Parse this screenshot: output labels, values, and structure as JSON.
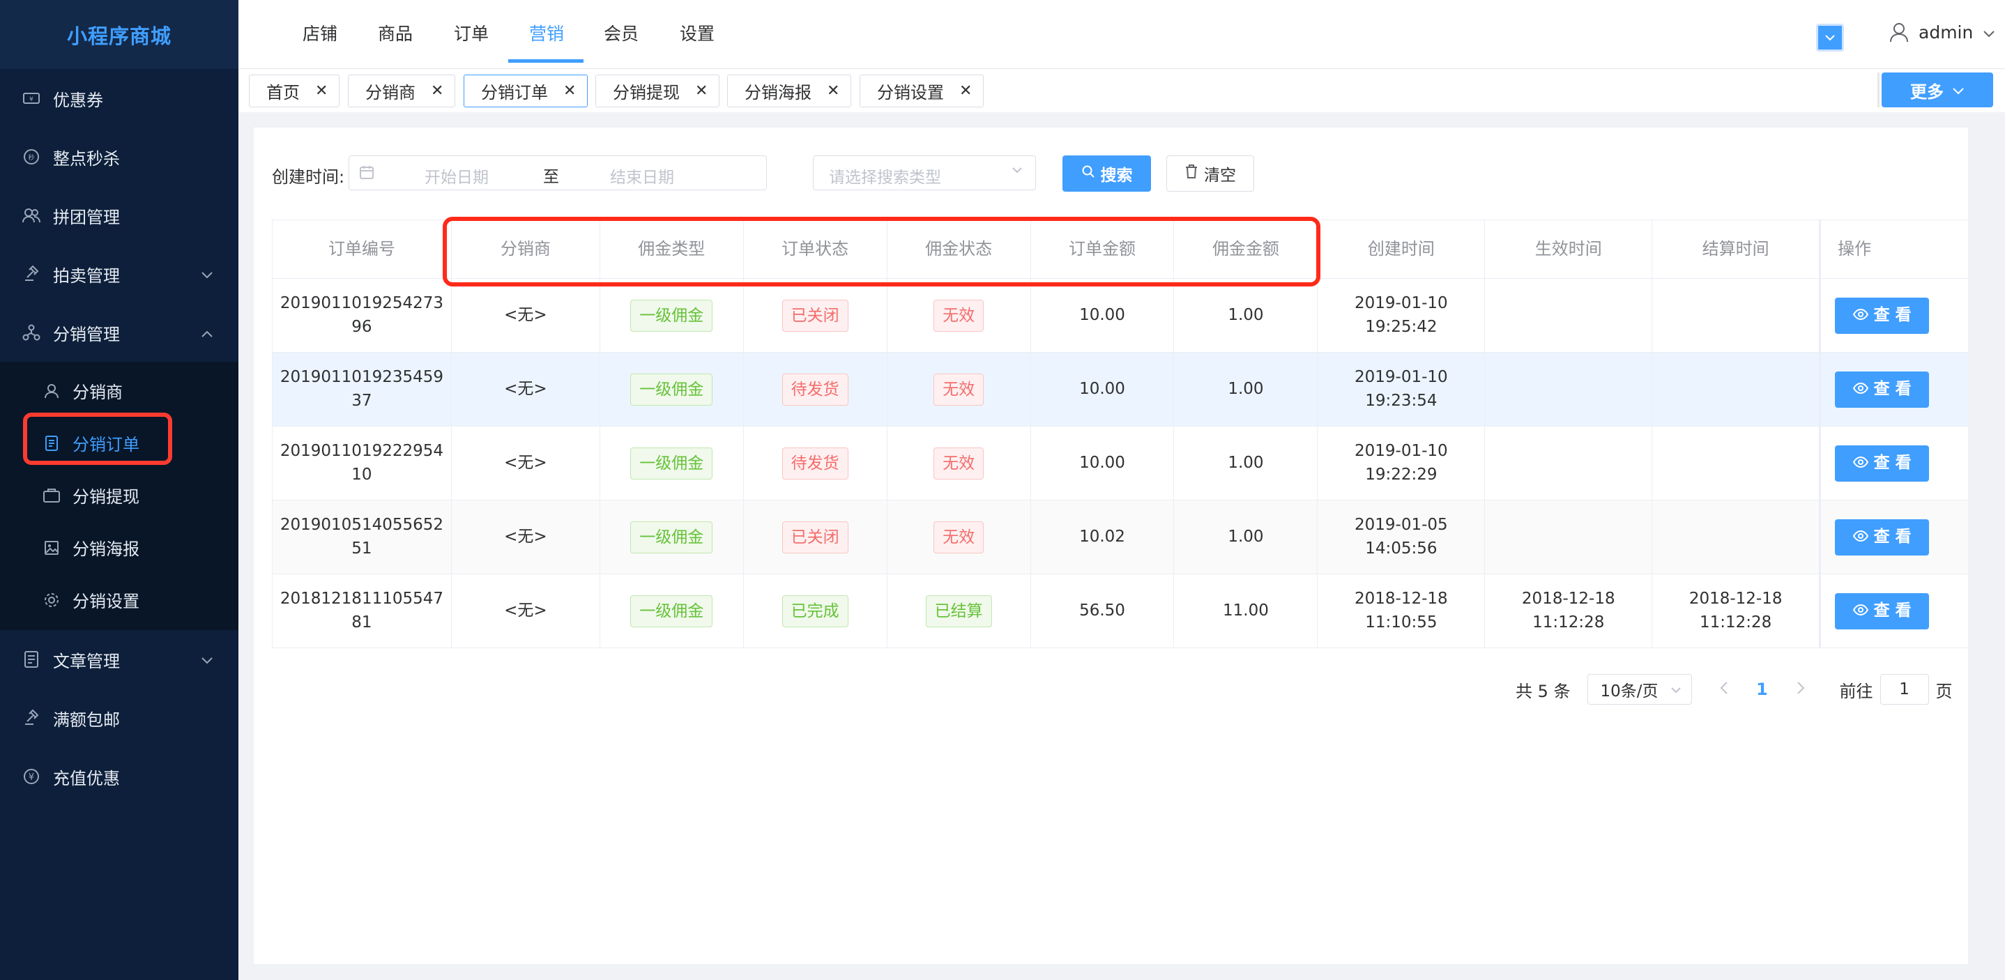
{
  "app": {
    "title": "小程序商城"
  },
  "sidebar": {
    "items": [
      {
        "label": "优惠券",
        "icon": "coupon-icon"
      },
      {
        "label": "整点秒杀",
        "icon": "flash-sale-icon"
      },
      {
        "label": "拼团管理",
        "icon": "group-buy-icon"
      },
      {
        "label": "拍卖管理",
        "icon": "auction-icon"
      },
      {
        "label": "分销管理",
        "icon": "distribution-icon"
      }
    ],
    "sub_items": [
      {
        "label": "分销商",
        "icon": "user-icon"
      },
      {
        "label": "分销订单",
        "icon": "document-icon"
      },
      {
        "label": "分销提现",
        "icon": "wallet-icon"
      },
      {
        "label": "分销海报",
        "icon": "poster-icon"
      },
      {
        "label": "分销设置",
        "icon": "gear-icon"
      }
    ],
    "bottom_items": [
      {
        "label": "文章管理",
        "icon": "article-icon"
      },
      {
        "label": "满额包邮",
        "icon": "shipping-icon"
      },
      {
        "label": "充值优惠",
        "icon": "yen-icon"
      }
    ]
  },
  "topnav": {
    "tabs": [
      "店铺",
      "商品",
      "订单",
      "营销",
      "会员",
      "设置"
    ],
    "active": "营销",
    "user": "admin"
  },
  "tags": {
    "items": [
      "首页",
      "分销商",
      "分销订单",
      "分销提现",
      "分销海报",
      "分销设置"
    ],
    "active": "分销订单",
    "more_label": "更多"
  },
  "filter": {
    "label": "创建时间:",
    "start_placeholder": "开始日期",
    "range_separator": "至",
    "end_placeholder": "结束日期",
    "type_placeholder": "请选择搜索类型",
    "search_label": "搜索",
    "clear_label": "清空"
  },
  "table": {
    "columns": [
      "订单编号",
      "分销商",
      "佣金类型",
      "订单状态",
      "佣金状态",
      "订单金额",
      "佣金金额",
      "创建时间",
      "生效时间",
      "结算时间",
      "操作"
    ],
    "view_label": "查 看",
    "rows": [
      {
        "order_no": "201901101925427396",
        "distributor": "<无>",
        "commission_type": "一级佣金",
        "order_status": "已关闭",
        "commission_status": "无效",
        "order_amount": "10.00",
        "commission_amount": "1.00",
        "created": "2019-01-10 19:25:42",
        "effective": "",
        "settled": ""
      },
      {
        "order_no": "201901101923545937",
        "distributor": "<无>",
        "commission_type": "一级佣金",
        "order_status": "待发货",
        "commission_status": "无效",
        "order_amount": "10.00",
        "commission_amount": "1.00",
        "created": "2019-01-10 19:23:54",
        "effective": "",
        "settled": ""
      },
      {
        "order_no": "201901101922295410",
        "distributor": "<无>",
        "commission_type": "一级佣金",
        "order_status": "待发货",
        "commission_status": "无效",
        "order_amount": "10.00",
        "commission_amount": "1.00",
        "created": "2019-01-10 19:22:29",
        "effective": "",
        "settled": ""
      },
      {
        "order_no": "201901051405565251",
        "distributor": "<无>",
        "commission_type": "一级佣金",
        "order_status": "已关闭",
        "commission_status": "无效",
        "order_amount": "10.02",
        "commission_amount": "1.00",
        "created": "2019-01-05 14:05:56",
        "effective": "",
        "settled": ""
      },
      {
        "order_no": "201812181110554781",
        "distributor": "<无>",
        "commission_type": "一级佣金",
        "order_status": "已完成",
        "commission_status": "已结算",
        "order_amount": "56.50",
        "commission_amount": "11.00",
        "created": "2018-12-18 11:10:55",
        "effective": "2018-12-18 11:12:28",
        "settled": "2018-12-18 11:12:28"
      }
    ]
  },
  "pagination": {
    "total_label": "共 5 条",
    "page_size": "10条/页",
    "current_page": "1",
    "goto_label": "前往",
    "goto_value": "1",
    "page_unit": "页"
  },
  "colors": {
    "primary": "#409eff",
    "sidebar_bg": "#0d1f3a",
    "highlight_box": "#ff2a1a",
    "success": "#67c23a",
    "danger": "#f56c6c"
  }
}
